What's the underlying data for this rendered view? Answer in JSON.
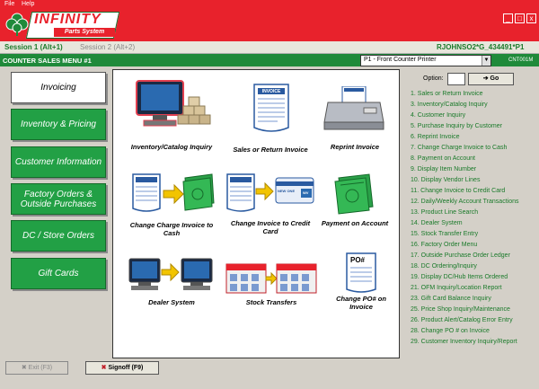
{
  "menubar": {
    "file": "File",
    "help": "Help"
  },
  "logo": {
    "name": "INFINITY",
    "sub": "Parts System"
  },
  "window_buttons": {
    "minimize": "_",
    "maximize": "□",
    "close": "x"
  },
  "sessions": {
    "session1": "Session 1 (Alt+1)",
    "session2": "Session 2 (Alt+2)",
    "user": "RJOHNSO2*G_434491*P1"
  },
  "menu": {
    "title": "COUNTER SALES MENU #1",
    "printer": "P1 - Front Counter Printer",
    "station": "CNT001M"
  },
  "nav": [
    {
      "label": "Invoicing",
      "active": true
    },
    {
      "label": "Inventory & Pricing",
      "active": false
    },
    {
      "label": "Customer Information",
      "active": false
    },
    {
      "label": "Factory Orders & Outside Purchases",
      "active": false
    },
    {
      "label": "DC / Store Orders",
      "active": false
    },
    {
      "label": "Gift Cards",
      "active": false
    }
  ],
  "tiles": [
    {
      "caption": "Inventory/Catalog Inquiry",
      "icon": "monitor-boxes-icon"
    },
    {
      "caption": "Sales or Return Invoice",
      "icon": "invoice-icon"
    },
    {
      "caption": "Reprint Invoice",
      "icon": "printer-icon"
    },
    {
      "caption": "Change Charge Invoice to Cash",
      "icon": "invoice-to-cash-icon"
    },
    {
      "caption": "Change Invoice to Credit Card",
      "icon": "invoice-to-card-icon"
    },
    {
      "caption": "Payment on Account",
      "icon": "money-icon"
    },
    {
      "caption": "Dealer System",
      "icon": "dealer-system-icon"
    },
    {
      "caption": "Stock Transfers",
      "icon": "stock-transfer-icon"
    },
    {
      "caption": "Change PO# on Invoice",
      "icon": "po-document-icon"
    }
  ],
  "tile_text": {
    "invoice": "INVOICE",
    "po": "PO#",
    "card_brand": "NEW ONE",
    "card_logo": "WV"
  },
  "options": {
    "label": "Option:",
    "go": "Go",
    "items": [
      "1. Sales or Return Invoice",
      "3. Inventory/Catalog Inquiry",
      "4. Customer Inquiry",
      "5. Purchase Inquiry by Customer",
      "6. Reprint Invoice",
      "7. Change Charge Invoice to Cash",
      "8. Payment on Account",
      "9. Display Item Number",
      "10. Display Vendor Lines",
      "11. Change Invoice to Credit Card",
      "12. Daily/Weekly Account Transactions",
      "13. Product Line Search",
      "14. Dealer System",
      "15. Stock Transfer Entry",
      "16. Factory Order Menu",
      "17. Outside Purchase Order Ledger",
      "18. DC Ordering/Inquiry",
      "19. Display DC/Hub Items Ordered",
      "21. OFM Inquiry/Location Report",
      "23. Gift Card Balance Inquiry",
      "25. Price Shop Inquiry/Maintenance",
      "26. Product Alert/Catalog Error Entry",
      "28. Change PO # on Invoice",
      "29. Customer Inventory Inquiry/Report"
    ]
  },
  "footer": {
    "exit": "Exit (F3)",
    "signoff": "Signoff (F9)"
  },
  "colors": {
    "brand_red": "#e8222c",
    "brand_green": "#1f8a3a",
    "button_green": "#22a045",
    "option_text": "#1a7a2a"
  }
}
